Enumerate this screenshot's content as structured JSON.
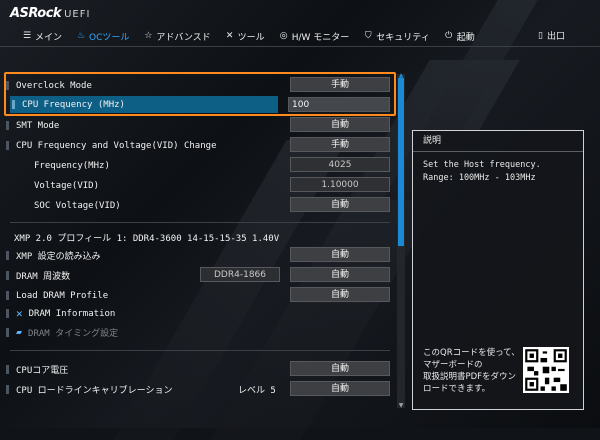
{
  "brand": {
    "name": "ASRock",
    "sub": "UEFI"
  },
  "tabs": [
    {
      "label": "メイン",
      "icon": "list-icon"
    },
    {
      "label": "OCツール",
      "icon": "flame-icon"
    },
    {
      "label": "アドバンスド",
      "icon": "star-icon"
    },
    {
      "label": "ツール",
      "icon": "tools-icon"
    },
    {
      "label": "H/W モニター",
      "icon": "monitor-icon"
    },
    {
      "label": "セキュリティ",
      "icon": "shield-icon"
    },
    {
      "label": "起動",
      "icon": "power-icon"
    },
    {
      "label": "出口",
      "icon": "exit-icon"
    }
  ],
  "settings": {
    "overclock_mode": {
      "label": "Overclock Mode",
      "value": "手動"
    },
    "cpu_frequency": {
      "label": "CPU Frequency (MHz)",
      "value": "100"
    },
    "smt_mode": {
      "label": "SMT Mode",
      "value": "自動"
    },
    "cpu_fv_change": {
      "label": "CPU Frequency and Voltage(VID) Change",
      "value": "手動"
    },
    "frequency": {
      "label": "Frequency(MHz)",
      "value": "4025"
    },
    "voltage": {
      "label": "Voltage(VID)",
      "value": "1.10000"
    },
    "soc_voltage": {
      "label": "SOC Voltage(VID)",
      "value": "自動"
    },
    "xmp_info": {
      "label": "XMP 2.0 プロフィール 1: DDR4-3600 14-15-15-35 1.40V"
    },
    "xmp_load": {
      "label": "XMP 設定の読み込み",
      "value": "自動"
    },
    "dram_freq": {
      "label": "DRAM 周波数",
      "detail": "DDR4-1866",
      "value": "自動"
    },
    "load_dram": {
      "label": "Load DRAM Profile",
      "value": "自動"
    },
    "dram_info": {
      "label": "DRAM Information"
    },
    "dram_timing": {
      "label": "DRAM タイミング設定"
    },
    "cpu_core_voltage": {
      "label": "CPUコア電圧",
      "value": "自動"
    },
    "cpu_llc": {
      "label": "CPU ロードラインキャリブレーション",
      "detail": "レベル 5",
      "value": "自動"
    }
  },
  "panel": {
    "title": "説明",
    "desc_line1": "Set the Host frequency.",
    "desc_line2": "Range: 100MHz - 103MHz",
    "qr_line1": "このQRコードを使って、",
    "qr_line2": "マザーボードの",
    "qr_line3": "取扱説明書PDFをダウン",
    "qr_line4": "ロードできます。"
  },
  "colors": {
    "accent": "#35a7ff",
    "highlight": "#ff8a1e",
    "selected": "#0e5f86"
  }
}
